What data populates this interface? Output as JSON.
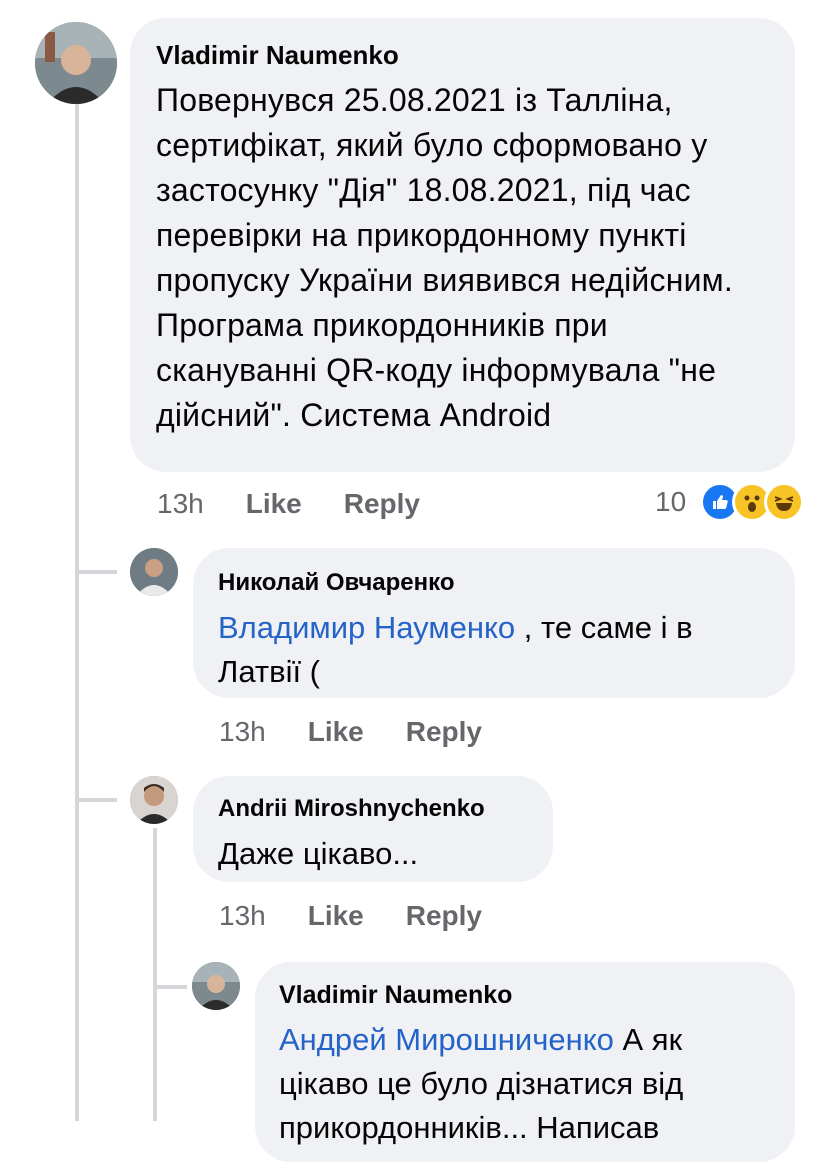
{
  "comments": [
    {
      "author": "Vladimir  Naumenko",
      "text": "Повернувся 25.08.2021 із Таллiна, сертифiкат, який було сформовано у застосунку \"Дiя\" 18.08.2021, пiд час перевiрки на прикордонному пунктi пропуску України виявився недiйсним. Програма прикордонникiв при скануваннi QR-коду iнформувала \"не дiйсний\". Система Android",
      "time": "13h",
      "like": "Like",
      "reply": "Reply",
      "reaction_count": "10",
      "reaction_icons": [
        "like-icon",
        "wow-icon",
        "haha-icon"
      ]
    },
    {
      "author": "Николай Овчаренко",
      "mention": "Владимир Науменко",
      "text": " , те саме і в Латвії (",
      "time": "13h",
      "like": "Like",
      "reply": "Reply"
    },
    {
      "author": "Andrii Miroshnychenko",
      "text": "Даже цікаво...",
      "time": "13h",
      "like": "Like",
      "reply": "Reply"
    },
    {
      "author": "Vladimir  Naumenko",
      "mention": "Андрей Мирошниченко",
      "text": " А як цікаво це було дізнатися від прикордонників... Написав"
    }
  ],
  "colors": {
    "bubble": "#eff1f4",
    "meta": "#65676b",
    "mention": "#2463c8",
    "like_reaction": "#1877f2",
    "emoji": "#f7c325"
  }
}
